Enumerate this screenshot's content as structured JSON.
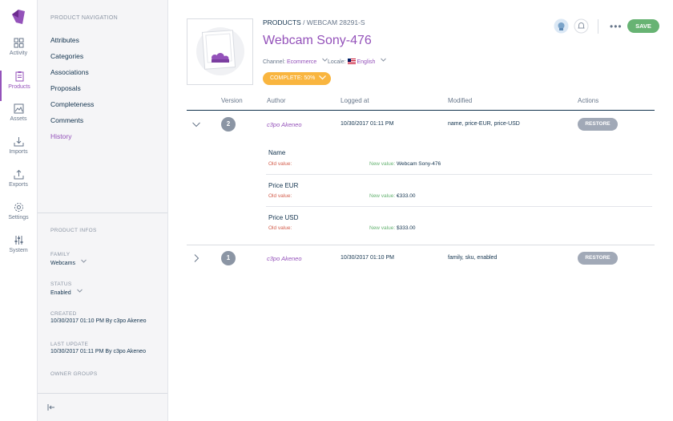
{
  "rail": {
    "items": [
      {
        "label": "Activity",
        "icon": "activity-icon"
      },
      {
        "label": "Products",
        "icon": "products-icon"
      },
      {
        "label": "Assets",
        "icon": "assets-icon"
      },
      {
        "label": "Imports",
        "icon": "imports-icon"
      },
      {
        "label": "Exports",
        "icon": "exports-icon"
      },
      {
        "label": "Settings",
        "icon": "settings-icon"
      },
      {
        "label": "System",
        "icon": "system-icon"
      }
    ],
    "accent": "#9452ba"
  },
  "nav": {
    "title": "Product navigation",
    "links": [
      "Attributes",
      "Categories",
      "Associations",
      "Proposals",
      "Completeness",
      "Comments",
      "History"
    ],
    "active": "History"
  },
  "info": {
    "title": "Product infos",
    "family_label": "Family",
    "family_value": "Webcams",
    "status_label": "Status",
    "status_value": "Enabled",
    "created_label": "Created",
    "created_value": "10/30/2017 01:10 PM By c3po Akeneo",
    "updated_label": "Last update",
    "updated_value": "10/30/2017 01:11 PM By c3po Akeneo",
    "owner_label": "Owner groups"
  },
  "header": {
    "crumb_products": "PRODUCTS",
    "crumb_sep": " / ",
    "crumb_sku": "WEBCAM 28291-S",
    "title": "Webcam Sony-476",
    "channel_label": "Channel:",
    "channel_value": "Ecommerce",
    "locale_label": "Locale:",
    "locale_value": "English",
    "complete": "COMPLETE: 50%",
    "save": "SAVE"
  },
  "table": {
    "headers": [
      "Version",
      "Author",
      "Logged at",
      "Modified",
      "Actions"
    ],
    "rows": [
      {
        "version": "2",
        "author": "c3po Akeneo",
        "logged": "10/30/2017 01:11 PM",
        "modified": "name, price-EUR, price-USD",
        "action": "RESTORE",
        "changes": [
          {
            "field": "Name",
            "old_label": "Old value:",
            "old_value": "",
            "new_label": "New value:",
            "new_value": "Webcam Sony-476"
          },
          {
            "field": "Price EUR",
            "old_label": "Old value:",
            "old_value": "",
            "new_label": "New value:",
            "new_value": "€333.00"
          },
          {
            "field": "Price USD",
            "old_label": "Old value:",
            "old_value": "",
            "new_label": "New value:",
            "new_value": "$333.00"
          }
        ]
      },
      {
        "version": "1",
        "author": "c3po Akeneo",
        "logged": "10/30/2017 01:10 PM",
        "modified": "family, sku, enabled",
        "action": "RESTORE"
      }
    ]
  },
  "colors": {
    "purple": "#9452ba",
    "orange": "#f9b53f",
    "green": "#67b373",
    "grey": "#a1a9b7",
    "red": "#d4604f"
  }
}
